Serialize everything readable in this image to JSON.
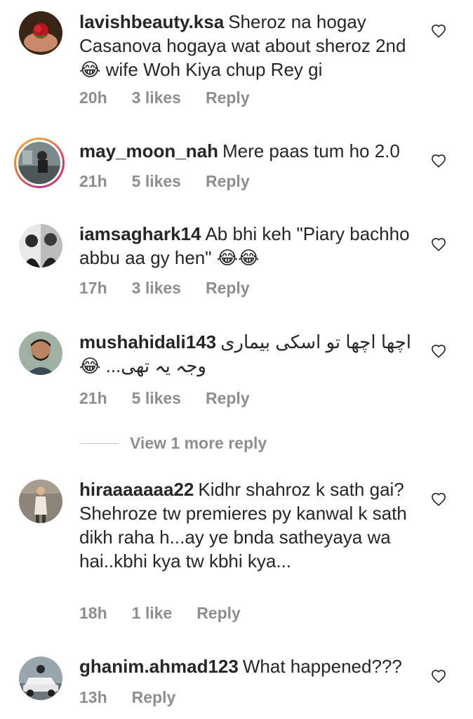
{
  "colors": {
    "text": "#262626",
    "meta": "#8e8e8e",
    "story_ring": "#e1306c"
  },
  "comments": [
    {
      "username": "lavishbeauty.ksa",
      "text": "Sheroz na hogay Casanova hogaya wat about sheroz 2nd😂 wife Woh Kiya chup Rey gi",
      "time": "20h",
      "likes": "3 likes",
      "reply": "Reply",
      "avatar": "rose-hand-avatar",
      "like_icon": "heart-outline-icon"
    },
    {
      "username": "may_moon_nah",
      "text": "Mere paas tum ho 2.0",
      "time": "21h",
      "likes": "5 likes",
      "reply": "Reply",
      "avatar": "story-ring-avatar",
      "like_icon": "heart-outline-icon"
    },
    {
      "username": "iamsaghark14",
      "text": "Ab bhi keh \"Piary bachho abbu aa gy hen\" 😂😂",
      "time": "17h",
      "likes": "3 likes",
      "reply": "Reply",
      "avatar": "couple-avatar",
      "like_icon": "heart-outline-icon"
    },
    {
      "username": "mushahidali143",
      "text": "اچھا اچھا تو اسکی بیماری وجہ یہ تھی... 😂",
      "time": "21h",
      "likes": "5 likes",
      "reply": "Reply",
      "avatar": "man-avatar",
      "like_icon": "heart-outline-icon"
    },
    {
      "username": "hiraaaaaaa22",
      "text": "Kidhr shahroz k sath gai? Shehroze tw premieres py kanwal k sath dikh raha h...ay ye bnda satheyaya wa hai..kbhi kya tw kbhi kya...",
      "time": "18h",
      "likes": "1 like",
      "reply": "Reply",
      "avatar": "woman-avatar",
      "like_icon": "heart-outline-icon"
    },
    {
      "username": "ghanim.ahmad123",
      "text": "What happened???",
      "time": "13h",
      "likes": "",
      "reply": "Reply",
      "avatar": "car-avatar",
      "like_icon": "heart-outline-icon"
    }
  ],
  "view_more": "View 1 more reply"
}
